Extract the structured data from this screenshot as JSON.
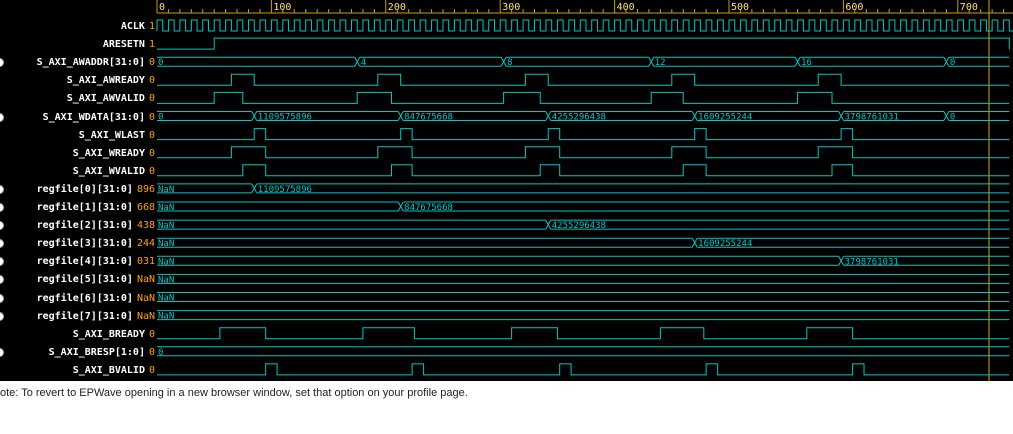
{
  "colors": {
    "bg": "#000000",
    "wave": "#00c8c8",
    "wave_high": "#00dd00",
    "name": "#ffffff",
    "value": "#ffa500",
    "ruler": "#c8a000",
    "ruler_text": "#ffe070",
    "cursor": "#d4b000"
  },
  "ruler": {
    "ticks": [
      "0",
      "100",
      "200",
      "300",
      "400",
      "500",
      "600",
      "700"
    ]
  },
  "signals": [
    {
      "name": "ACLK",
      "value": "1",
      "radio": false
    },
    {
      "name": "ARESETN",
      "value": "1",
      "radio": false
    },
    {
      "name": "S_AXI_AWADDR[31:0]",
      "value": "0",
      "radio": true
    },
    {
      "name": "S_AXI_AWREADY",
      "value": "0",
      "radio": false
    },
    {
      "name": "S_AXI_AWVALID",
      "value": "0",
      "radio": false
    },
    {
      "name": "S_AXI_WDATA[31:0]",
      "value": "0",
      "radio": true
    },
    {
      "name": "S_AXI_WLAST",
      "value": "0",
      "radio": false
    },
    {
      "name": "S_AXI_WREADY",
      "value": "0",
      "radio": false
    },
    {
      "name": "S_AXI_WVALID",
      "value": "0",
      "radio": false
    },
    {
      "name": "regfile[0][31:0]",
      "value": "896",
      "radio": true
    },
    {
      "name": "regfile[1][31:0]",
      "value": "668",
      "radio": true
    },
    {
      "name": "regfile[2][31:0]",
      "value": "438",
      "radio": true
    },
    {
      "name": "regfile[3][31:0]",
      "value": "244",
      "radio": true
    },
    {
      "name": "regfile[4][31:0]",
      "value": "031",
      "radio": true
    },
    {
      "name": "regfile[5][31:0]",
      "value": "NaN",
      "radio": true
    },
    {
      "name": "regfile[6][31:0]",
      "value": "NaN",
      "radio": true
    },
    {
      "name": "regfile[7][31:0]",
      "value": "NaN",
      "radio": true
    },
    {
      "name": "S_AXI_BREADY",
      "value": "0",
      "radio": false
    },
    {
      "name": "S_AXI_BRESP[1:0]",
      "value": "0",
      "radio": true
    },
    {
      "name": "S_AXI_BVALID",
      "value": "0",
      "radio": false
    }
  ],
  "bus_labels": {
    "awaddr": [
      "0",
      "4",
      "8",
      "12",
      "16",
      "0"
    ],
    "wdata": [
      "0",
      "1109575896",
      "847675668",
      "4255296438",
      "1609255244",
      "3798761031",
      "0"
    ],
    "regfile": [
      [
        "NaN",
        "1109575896"
      ],
      [
        "NaN",
        "847675668"
      ],
      [
        "NaN",
        "4255296438"
      ],
      [
        "NaN",
        "1609255244"
      ],
      [
        "NaN",
        "3798761031"
      ],
      [
        "NaN"
      ],
      [
        "NaN"
      ],
      [
        "NaN"
      ]
    ],
    "bresp": [
      "0"
    ]
  },
  "note": "ote: To revert to EPWave opening in a new browser window, set that option on your profile page."
}
